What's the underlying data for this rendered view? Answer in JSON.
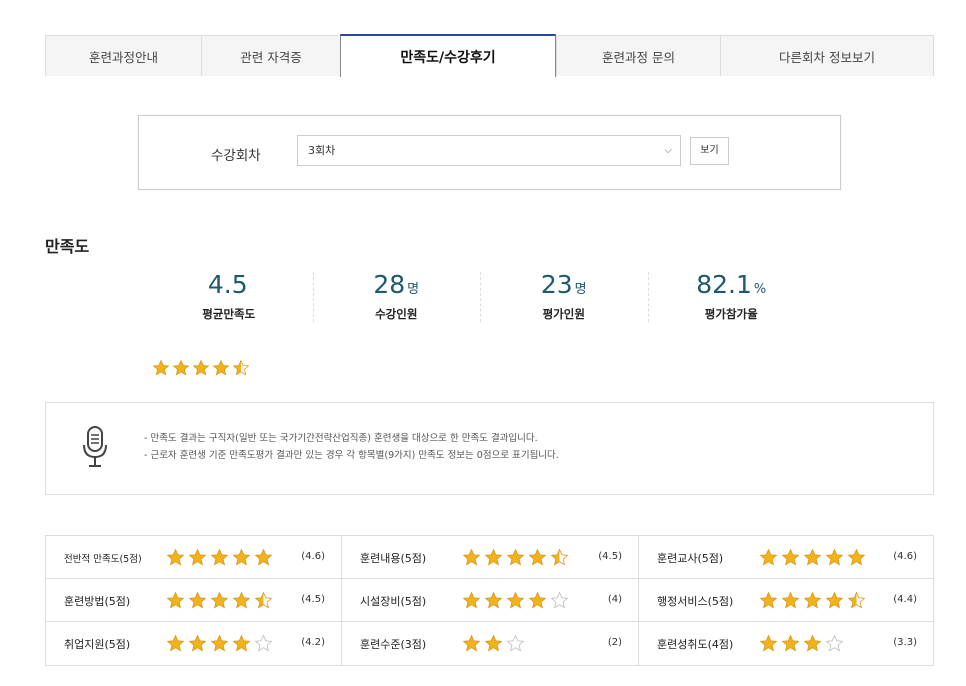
{
  "tabs": [
    {
      "label": "훈련과정안내",
      "active": false
    },
    {
      "label": "관련 자격증",
      "active": false
    },
    {
      "label": "만족도/수강후기",
      "active": true
    },
    {
      "label": "훈련과정 문의",
      "active": false
    },
    {
      "label": "다른회차 정보보기",
      "active": false
    }
  ],
  "session": {
    "label": "수강회차",
    "selected": "3회차",
    "view_button": "보기"
  },
  "satisfaction": {
    "title": "만족도",
    "stats": [
      {
        "value": "4.5",
        "unit": "",
        "label": "평균만족도"
      },
      {
        "value": "28",
        "unit": "명",
        "label": "수강인원"
      },
      {
        "value": "23",
        "unit": "명",
        "label": "평가인원"
      },
      {
        "value": "82.1",
        "unit": "%",
        "label": "평가참가율"
      }
    ],
    "stars": 4.5,
    "star_max": 5
  },
  "notice": {
    "icon": "microphone-icon",
    "lines": [
      "- 만족도 결과는 구직자(일반 또는 국가기간전략산업직종) 훈련생을 대상으로 한 만족도 결과입니다.",
      "- 근로자 훈련생 기준 만족도평가 결과만 있는 경우 각 항목별(9가지) 만족도 정보는 0점으로 표기됩니다."
    ]
  },
  "ratings": [
    {
      "label": "전반적 만족도(5점)",
      "stars": 5,
      "max": 5,
      "score": "(4.6)",
      "small": true
    },
    {
      "label": "훈련내용(5점)",
      "stars": 4.5,
      "max": 5,
      "score": "(4.5)"
    },
    {
      "label": "훈련교사(5점)",
      "stars": 5,
      "max": 5,
      "score": "(4.6)"
    },
    {
      "label": "훈련방법(5점)",
      "stars": 4.5,
      "max": 5,
      "score": "(4.5)"
    },
    {
      "label": "시설장비(5점)",
      "stars": 4,
      "max": 5,
      "score": "(4)"
    },
    {
      "label": "행정서비스(5점)",
      "stars": 4.5,
      "max": 5,
      "score": "(4.4)"
    },
    {
      "label": "취업지원(5점)",
      "stars": 4,
      "max": 5,
      "score": "(4.2)"
    },
    {
      "label": "훈련수준(3점)",
      "stars": 2,
      "max": 3,
      "score": "(2)"
    },
    {
      "label": "훈련성취도(4점)",
      "stars": 3,
      "max": 4,
      "score": "(3.3)"
    }
  ],
  "colors": {
    "accent": "#2b4a9b",
    "stat_value": "#1e5a6b",
    "star_fill": "#f1b21a",
    "star_empty": "#d5d5d5"
  }
}
